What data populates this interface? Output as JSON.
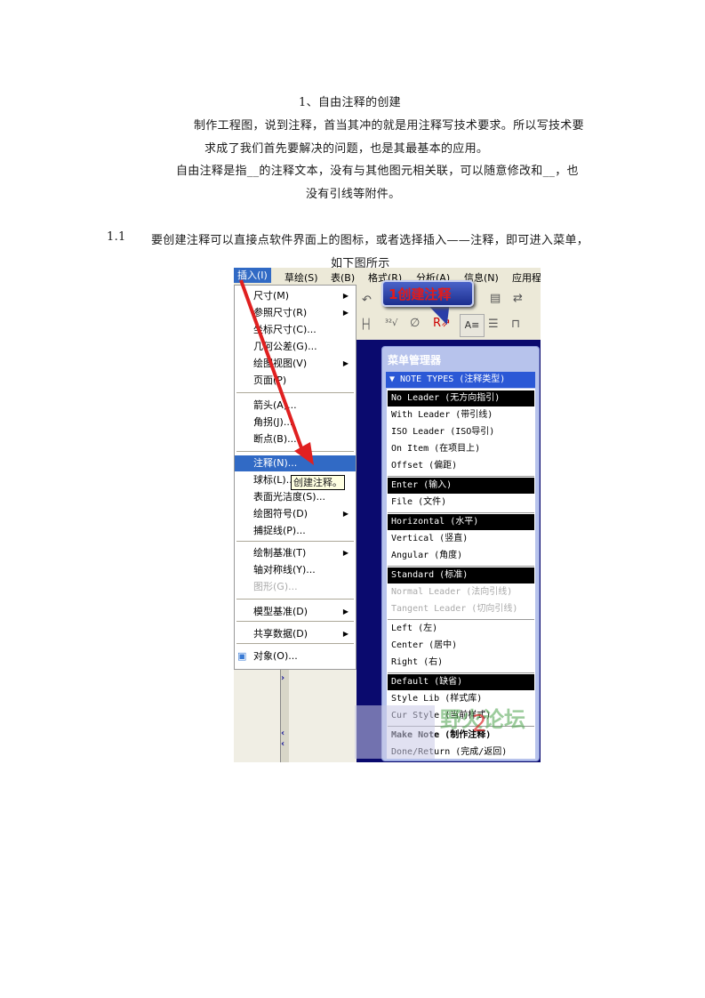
{
  "document": {
    "title": "1、自由注释的创建",
    "para1_line1": "制作工程图，说到注释，首当其冲的就是用注释写技术要求。所以写技术要",
    "para1_line2": "求成了我们首先要解决的问题，也是其最基本的应用。",
    "para2_line1": "自由注释是指__的注释文本，没有与其他图元相关联，可以随意修改和__，也",
    "para2_line2": "没有引线等附件。",
    "section_number": "1.1",
    "section_line1": "要创建注释可以直接点软件界面上的图标，或者选择插入——注释，即可进入菜单，",
    "section_line2": "如下图所示"
  },
  "screenshot": {
    "menubar": [
      "插入(I)",
      "草绘(S)",
      "表(B)",
      "格式(R)",
      "分析(A)",
      "信息(N)",
      "应用程"
    ],
    "callout1": "1创建注释",
    "tooltip": "创建注释。",
    "insert_menu": [
      {
        "label": "尺寸(M)",
        "submenu": true
      },
      {
        "label": "参照尺寸(R)",
        "submenu": true
      },
      {
        "label": "坐标尺寸(C)...",
        "submenu": false
      },
      {
        "label": "几何公差(G)...",
        "submenu": false
      },
      {
        "label": "绘图视图(V)",
        "submenu": true
      },
      {
        "label": "页面(P)",
        "submenu": false
      },
      {
        "label": "箭头(A)...",
        "submenu": false
      },
      {
        "label": "角拐(J)...",
        "submenu": false
      },
      {
        "label": "断点(B)...",
        "submenu": false
      },
      {
        "label": "注释(N)...",
        "submenu": false,
        "highlighted": true
      },
      {
        "label": "球标(L)...",
        "submenu": false
      },
      {
        "label": "表面光洁度(S)...",
        "submenu": false
      },
      {
        "label": "绘图符号(D)",
        "submenu": true
      },
      {
        "label": "捕捉线(P)...",
        "submenu": false
      },
      {
        "label": "绘制基准(T)",
        "submenu": true
      },
      {
        "label": "轴对称线(Y)...",
        "submenu": false
      },
      {
        "label": "图形(G)...",
        "submenu": false,
        "disabled": true
      },
      {
        "label": "模型基准(D)",
        "submenu": true
      },
      {
        "label": "共享数据(D)",
        "submenu": true
      },
      {
        "label": "对象(O)...",
        "submenu": false
      }
    ],
    "menu_manager": {
      "title": "菜单管理器",
      "header": "▼ NOTE TYPES (注释类型)",
      "items": [
        {
          "label": "No Leader (无方向指引)",
          "selected": true
        },
        {
          "label": "With Leader (带引线)"
        },
        {
          "label": "ISO Leader (ISO导引)"
        },
        {
          "label": "On Item (在项目上)"
        },
        {
          "label": "Offset (偏距)"
        },
        {
          "label": "Enter (输入)",
          "selected": true
        },
        {
          "label": "File (文件)"
        },
        {
          "label": "Horizontal (水平)",
          "selected": true
        },
        {
          "label": "Vertical (竖直)"
        },
        {
          "label": "Angular (角度)"
        },
        {
          "label": "Standard (标准)",
          "selected": true
        },
        {
          "label": "Normal Leader (法向引线)",
          "disabled": true
        },
        {
          "label": "Tangent Leader (切向引线)",
          "disabled": true
        },
        {
          "label": "Left (左)"
        },
        {
          "label": "Center (居中)"
        },
        {
          "label": "Right (右)"
        },
        {
          "label": "Default (缺省)",
          "selected": true
        },
        {
          "label": "Style Lib (样式库)"
        },
        {
          "label": "Cur Style (当前样式)"
        },
        {
          "label": "Make Note (制作注释)",
          "bold": true
        },
        {
          "label": "Done/Return (完成/返回)"
        }
      ]
    },
    "watermark_text": "野火论坛",
    "callout2": "2",
    "colors": {
      "menu_highlight": "#316ac5",
      "callout_text": "#e21b1b",
      "canvas": "#0a0a6e"
    }
  }
}
